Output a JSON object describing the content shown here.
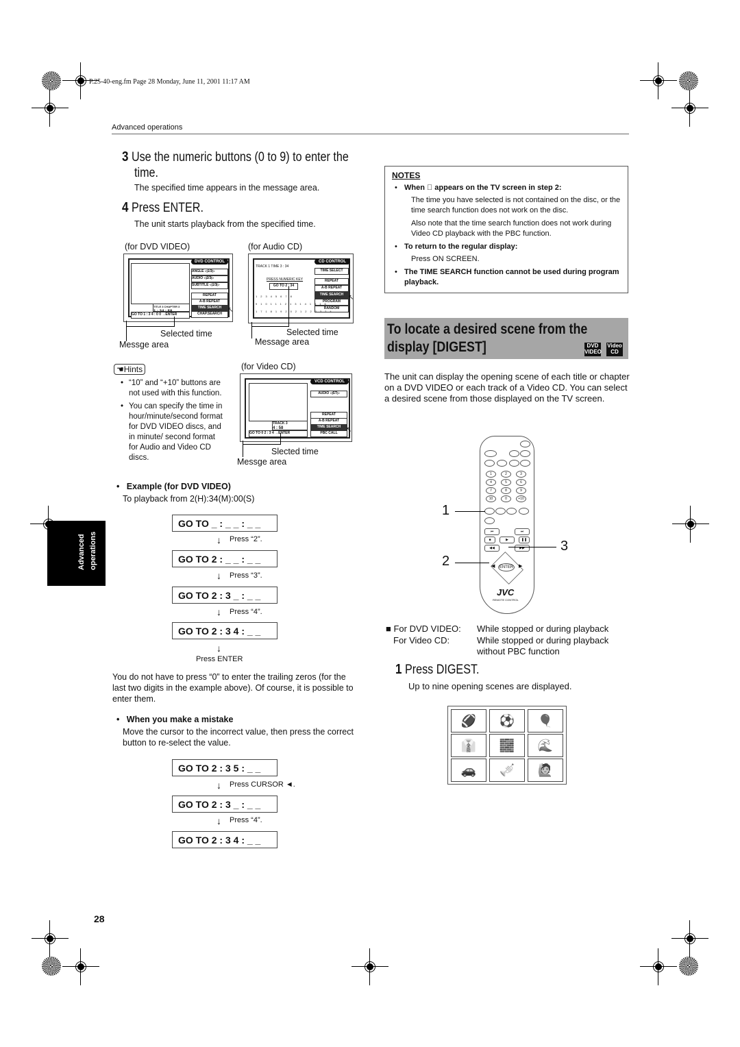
{
  "file_info": "P.25-40-eng.fm  Page 28  Monday, June 11, 2001  11:17 AM",
  "section_header": "Advanced operations",
  "side_tab": [
    "Advanced",
    "operations"
  ],
  "page_number": "28",
  "steps_left": [
    {
      "num": "3",
      "title": "Use the numeric buttons (0 to 9) to enter the",
      "title2": "time.",
      "desc": "The specified time appears in the message area."
    },
    {
      "num": "4",
      "title": "Press ENTER.",
      "desc": "The unit starts playback from the specified time."
    }
  ],
  "screens": {
    "dvd": {
      "caption": "(for DVD VIDEO)",
      "title": "DVD CONTROL",
      "rows": [
        {
          "label": "ANGLE",
          "value": "1/3"
        },
        {
          "label": "AUDIO",
          "value": "2/3"
        },
        {
          "label": "SUBTITLE",
          "value": "1/3"
        }
      ],
      "menu": [
        "REPEAT",
        "A-B REPEAT",
        "TIME SEARCH",
        "CHAP.SEARCH"
      ],
      "selected": "TIME SEARCH",
      "info": "TITLE 3  CHAPTER 3",
      "time": "1 : 34 : 58",
      "goto": "GO TO",
      "goto_value": "1 : 3 4 : 0 0",
      "enter": "→ENTER",
      "label_time": "Selected time",
      "label_msg": "Messge area"
    },
    "cd": {
      "caption": "(for Audio CD)",
      "title": "CD CONTROL",
      "track": "TRACK  1   TIME  3 : 34",
      "menu": [
        "TIME SELECT",
        "REPEAT",
        "A-B REPEAT",
        "TIME SEARCH",
        "PROGRAM",
        "RANDOM"
      ],
      "selected": "TIME SEARCH",
      "press_key": "PRESS NUMERIC KEY",
      "goto": "GO TO",
      "goto_value": "2 : 34",
      "label_time": "Selected time",
      "label_msg": "Message area"
    },
    "vcd": {
      "caption": "(for Video CD)",
      "title": "VCD CONTROL",
      "audio_label": "AUDIO",
      "audio_value": "ST",
      "menu": [
        "REPEAT",
        "A-B REPEAT",
        "TIME SEARCH",
        "PBC CALL"
      ],
      "selected": "TIME SEARCH",
      "track": "TRACK 3",
      "time": "4 : 58",
      "goto": "GO TO  0 2 : 3 4",
      "enter": "→ENTER",
      "label_time": "Slected time",
      "label_msg": "Messge area"
    }
  },
  "hints": {
    "label": "Hints",
    "items": [
      "“10” and “+10” buttons are not used with this function.",
      "You can specify the time in hour/minute/second format for DVD VIDEO discs, and in minute/ second format for Audio and Video CD discs."
    ]
  },
  "example": {
    "title": "Example (for DVD VIDEO)",
    "desc": "To playback from 2(H):34(M):00(S)",
    "sequence": [
      {
        "display": "GO TO  _ : _ _ : _ _",
        "action": "Press “2”."
      },
      {
        "display": "GO TO  2 : _ _ : _ _",
        "action": "Press “3”."
      },
      {
        "display": "GO TO  2 : 3 _ : _ _",
        "action": "Press “4”."
      },
      {
        "display": "GO TO  2 : 3 4 : _ _",
        "action": "Press ENTER"
      }
    ]
  },
  "trailing_note": "You do not have to press “0” to enter the trailing zeros (for the last two digits in the example above). Of course, it is possible to enter them.",
  "mistake": {
    "title": "When you make a mistake",
    "desc": "Move the cursor to the incorrect value, then press the correct button to re-select the value.",
    "sequence": [
      {
        "display": "GO TO  2 : 3 5 : _ _",
        "action": "Press CURSOR ◄."
      },
      {
        "display": "GO TO  2 : 3 _ : _ _",
        "action": "Press “4”."
      },
      {
        "display": "GO TO  2 : 3 4 : _ _",
        "action": ""
      }
    ]
  },
  "notes": {
    "title": "NOTES",
    "items": [
      {
        "head": "When ⃠ appears on the TV screen in step 2:",
        "body": [
          "The time you have selected is not contained on the disc, or the time search function does not work on the disc.",
          "Also note that the time search function does not work during Video CD playback with the PBC function."
        ]
      },
      {
        "head": "To return to the regular display:",
        "body": [
          "Press ON SCREEN."
        ]
      },
      {
        "head": "The TIME SEARCH function cannot be used during program playback.",
        "body": []
      }
    ]
  },
  "digest_section": {
    "title_line1": "To locate a desired scene from the",
    "title_line2": "display [DIGEST]",
    "badges": [
      {
        "top": "DVD",
        "bottom": "VIDEO"
      },
      {
        "top": "Video",
        "bottom": "CD"
      }
    ],
    "intro": "The unit can display the opening scene of each title or chapter on a DVD VIDEO or each track of a Video CD.  You can select a desired scene from those displayed on the TV screen.",
    "callouts": [
      "1",
      "2",
      "3"
    ],
    "remote_brand": "JVC",
    "remote_label": "REMOTE CONTROL",
    "remote_keys": [
      "1",
      "2",
      "3",
      "4",
      "5",
      "6",
      "7",
      "8",
      "9",
      "10",
      "0",
      "+10"
    ],
    "enter_key": "ENTER",
    "conditions": [
      {
        "label": "For DVD VIDEO:",
        "value": "While stopped or during playback"
      },
      {
        "label": "For Video CD:",
        "value": "While stopped or during playback without PBC function"
      }
    ],
    "step": {
      "num": "1",
      "title": "Press DIGEST.",
      "desc": "Up to nine opening scenes are displayed."
    },
    "thumbnails": [
      "football-player",
      "soccer-players",
      "balloons",
      "man-in-suit",
      "man-at-wall",
      "seaside-scene",
      "street-car",
      "trumpet-player",
      "waving-child"
    ]
  }
}
